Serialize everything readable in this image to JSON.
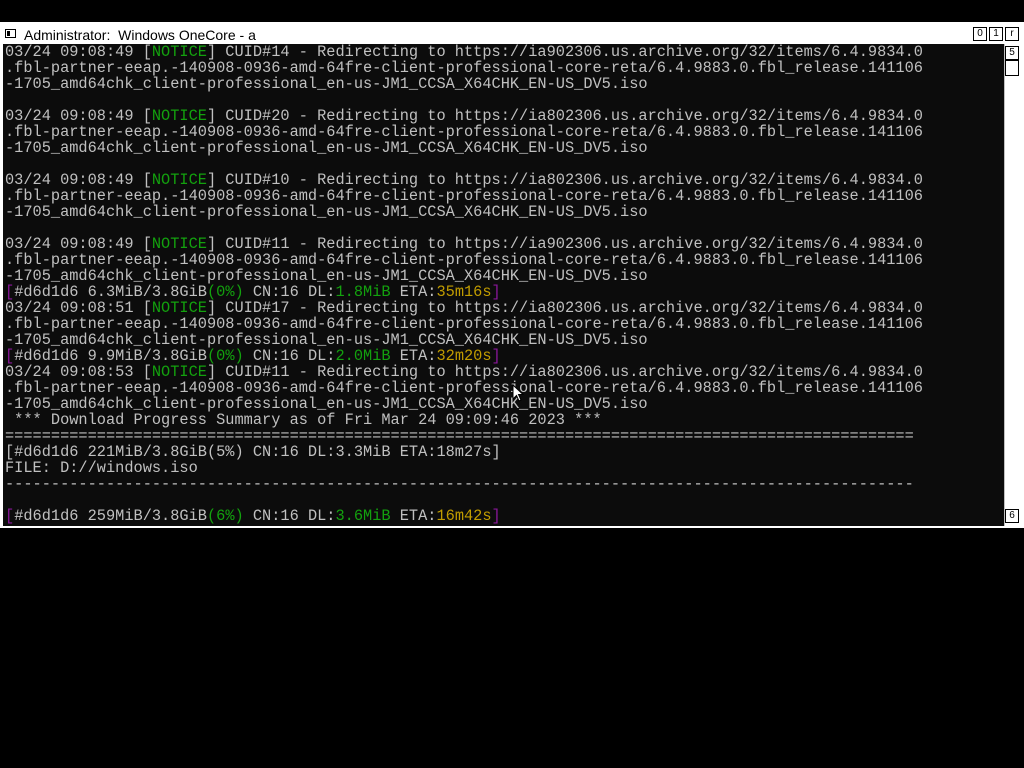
{
  "window": {
    "title": "Administrator:  Windows OneCore - a",
    "controls": {
      "minimize": "0",
      "maximize": "1",
      "close": "r"
    },
    "scroll_up": "5",
    "scroll_down": "6"
  },
  "console": {
    "lines": [
      [
        {
          "t": "03/24 09:08:49 ["
        },
        {
          "t": "NOTICE",
          "c": "notice"
        },
        {
          "t": "] CUID#14 - Redirecting to https://ia902306.us.archive.org/32/items/6.4.9834.0"
        }
      ],
      [
        {
          "t": ".fbl-partner-eeap.-140908-0936-amd-64fre-client-professional-core-reta/6.4.9883.0.fbl_release.141106"
        }
      ],
      [
        {
          "t": "-1705_amd64chk_client-professional_en-us-JM1_CCSA_X64CHK_EN-US_DV5.iso"
        }
      ],
      [
        {
          "t": ""
        }
      ],
      [
        {
          "t": "03/24 09:08:49 ["
        },
        {
          "t": "NOTICE",
          "c": "notice"
        },
        {
          "t": "] CUID#20 - Redirecting to https://ia802306.us.archive.org/32/items/6.4.9834.0"
        }
      ],
      [
        {
          "t": ".fbl-partner-eeap.-140908-0936-amd-64fre-client-professional-core-reta/6.4.9883.0.fbl_release.141106"
        }
      ],
      [
        {
          "t": "-1705_amd64chk_client-professional_en-us-JM1_CCSA_X64CHK_EN-US_DV5.iso"
        }
      ],
      [
        {
          "t": ""
        }
      ],
      [
        {
          "t": "03/24 09:08:49 ["
        },
        {
          "t": "NOTICE",
          "c": "notice"
        },
        {
          "t": "] CUID#10 - Redirecting to https://ia802306.us.archive.org/32/items/6.4.9834.0"
        }
      ],
      [
        {
          "t": ".fbl-partner-eeap.-140908-0936-amd-64fre-client-professional-core-reta/6.4.9883.0.fbl_release.141106"
        }
      ],
      [
        {
          "t": "-1705_amd64chk_client-professional_en-us-JM1_CCSA_X64CHK_EN-US_DV5.iso"
        }
      ],
      [
        {
          "t": ""
        }
      ],
      [
        {
          "t": "03/24 09:08:49 ["
        },
        {
          "t": "NOTICE",
          "c": "notice"
        },
        {
          "t": "] CUID#11 - Redirecting to https://ia902306.us.archive.org/32/items/6.4.9834.0"
        }
      ],
      [
        {
          "t": ".fbl-partner-eeap.-140908-0936-amd-64fre-client-professional-core-reta/6.4.9883.0.fbl_release.141106"
        }
      ],
      [
        {
          "t": "-1705_amd64chk_client-professional_en-us-JM1_CCSA_X64CHK_EN-US_DV5.iso"
        }
      ],
      [
        {
          "t": "[",
          "c": "magenta"
        },
        {
          "t": "#d6d1d6 6.3MiB/3.8GiB"
        },
        {
          "t": "(0%)",
          "c": "green"
        },
        {
          "t": " CN:16 DL:"
        },
        {
          "t": "1.8MiB",
          "c": "green"
        },
        {
          "t": " ETA:"
        },
        {
          "t": "35m16s",
          "c": "yellow"
        },
        {
          "t": "]",
          "c": "magenta"
        }
      ],
      [
        {
          "t": "03/24 09:08:51 ["
        },
        {
          "t": "NOTICE",
          "c": "notice"
        },
        {
          "t": "] CUID#17 - Redirecting to https://ia802306.us.archive.org/32/items/6.4.9834.0"
        }
      ],
      [
        {
          "t": ".fbl-partner-eeap.-140908-0936-amd-64fre-client-professional-core-reta/6.4.9883.0.fbl_release.141106"
        }
      ],
      [
        {
          "t": "-1705_amd64chk_client-professional_en-us-JM1_CCSA_X64CHK_EN-US_DV5.iso"
        }
      ],
      [
        {
          "t": "[",
          "c": "magenta"
        },
        {
          "t": "#d6d1d6 9.9MiB/3.8GiB"
        },
        {
          "t": "(0%)",
          "c": "green"
        },
        {
          "t": " CN:16 DL:"
        },
        {
          "t": "2.0MiB",
          "c": "green"
        },
        {
          "t": " ETA:"
        },
        {
          "t": "32m20s",
          "c": "yellow"
        },
        {
          "t": "]",
          "c": "magenta"
        }
      ],
      [
        {
          "t": "03/24 09:08:53 ["
        },
        {
          "t": "NOTICE",
          "c": "notice"
        },
        {
          "t": "] CUID#11 - Redirecting to https://ia802306.us.archive.org/32/items/6.4.9834.0"
        }
      ],
      [
        {
          "t": ".fbl-partner-eeap.-140908-0936-amd-64fre-client-professional-core-reta/6.4.9883.0.fbl_release.141106"
        }
      ],
      [
        {
          "t": "-1705_amd64chk_client-professional_en-us-JM1_CCSA_X64CHK_EN-US_DV5.iso"
        }
      ],
      [
        {
          "t": " *** Download Progress Summary as of Fri Mar 24 09:09:46 2023 ***"
        }
      ],
      [
        {
          "t": "==================================================================================================="
        }
      ],
      [
        {
          "t": "[#d6d1d6 221MiB/3.8GiB(5%) CN:16 DL:3.3MiB ETA:18m27s]"
        }
      ],
      [
        {
          "t": "FILE: D://windows.iso"
        }
      ],
      [
        {
          "t": "---------------------------------------------------------------------------------------------------"
        }
      ],
      [
        {
          "t": ""
        }
      ],
      [
        {
          "t": "[",
          "c": "magenta"
        },
        {
          "t": "#d6d1d6 259MiB/3.8GiB"
        },
        {
          "t": "(6%)",
          "c": "green"
        },
        {
          "t": " CN:16 DL:"
        },
        {
          "t": "3.6MiB",
          "c": "green"
        },
        {
          "t": " ETA:"
        },
        {
          "t": "16m42s",
          "c": "yellow"
        },
        {
          "t": "]",
          "c": "magenta"
        }
      ]
    ]
  },
  "colors": {
    "notice": "#13a10e",
    "bracket": "#881798",
    "eta": "#c19c00",
    "text": "#c0c0c0",
    "background": "#0c0c0c"
  }
}
